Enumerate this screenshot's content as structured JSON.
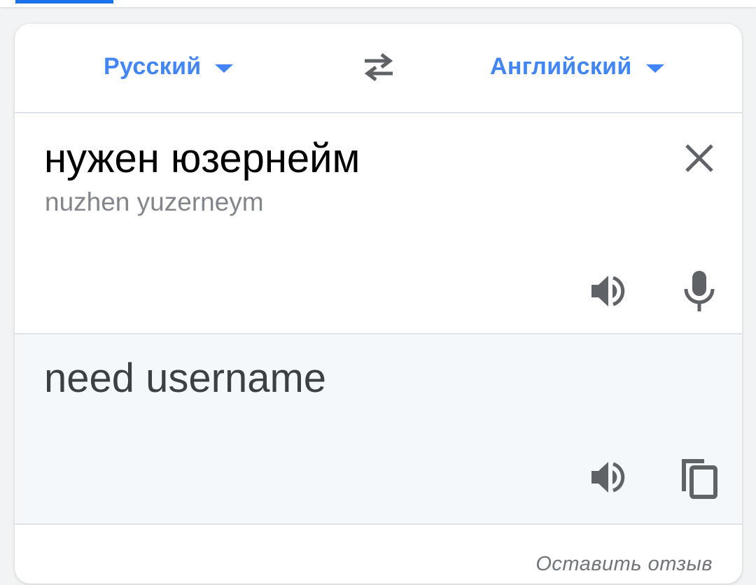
{
  "languages": {
    "source": "Русский",
    "target": "Английский"
  },
  "source": {
    "text": "нужен юзернейм",
    "transliteration": "nuzhen yuzerneym"
  },
  "result": {
    "text": "need username"
  },
  "footer": {
    "feedback": "Оставить отзыв"
  },
  "icons": {
    "swap": "swap-arrows-icon",
    "clear": "close-icon",
    "source_speaker": "speaker-icon",
    "mic": "microphone-icon",
    "result_speaker": "speaker-icon",
    "copy": "copy-icon"
  },
  "colors": {
    "accent": "#4285f4",
    "tab_indicator": "#1a73e8",
    "icon": "#5f6368",
    "result_background": "#f5f8fa",
    "transliteration": "#80868b"
  }
}
